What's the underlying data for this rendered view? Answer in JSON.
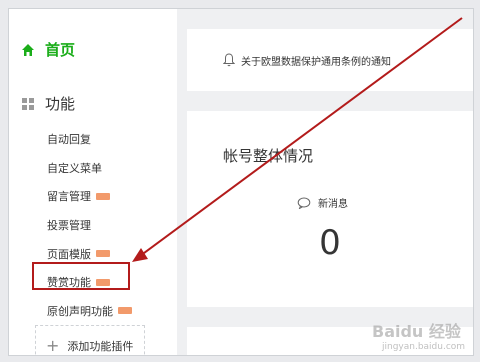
{
  "sidebar": {
    "home": {
      "label": "首页",
      "icon": "home-icon"
    },
    "section": {
      "label": "功能",
      "icon": "grid-icon"
    },
    "items": [
      {
        "label": "自动回复",
        "badge": false
      },
      {
        "label": "自定义菜单",
        "badge": false
      },
      {
        "label": "留言管理",
        "badge": true
      },
      {
        "label": "投票管理",
        "badge": false
      },
      {
        "label": "页面模版",
        "badge": true
      },
      {
        "label": "赞赏功能",
        "badge": true
      },
      {
        "label": "原创声明功能",
        "badge": true
      }
    ],
    "add_plugin_label": "添加功能插件"
  },
  "notice": {
    "icon": "bell-icon",
    "text": "关于欧盟数据保护通用条例的通知"
  },
  "overview": {
    "title": "帐号整体情况",
    "new_messages_label": "新消息",
    "new_messages_count": "0"
  },
  "watermark": {
    "brand": "Baidu 经验",
    "url": "jingyan.baidu.com"
  },
  "colors": {
    "accent": "#1aad19",
    "highlight": "#b31b1b",
    "badge": "#f29a6b"
  }
}
